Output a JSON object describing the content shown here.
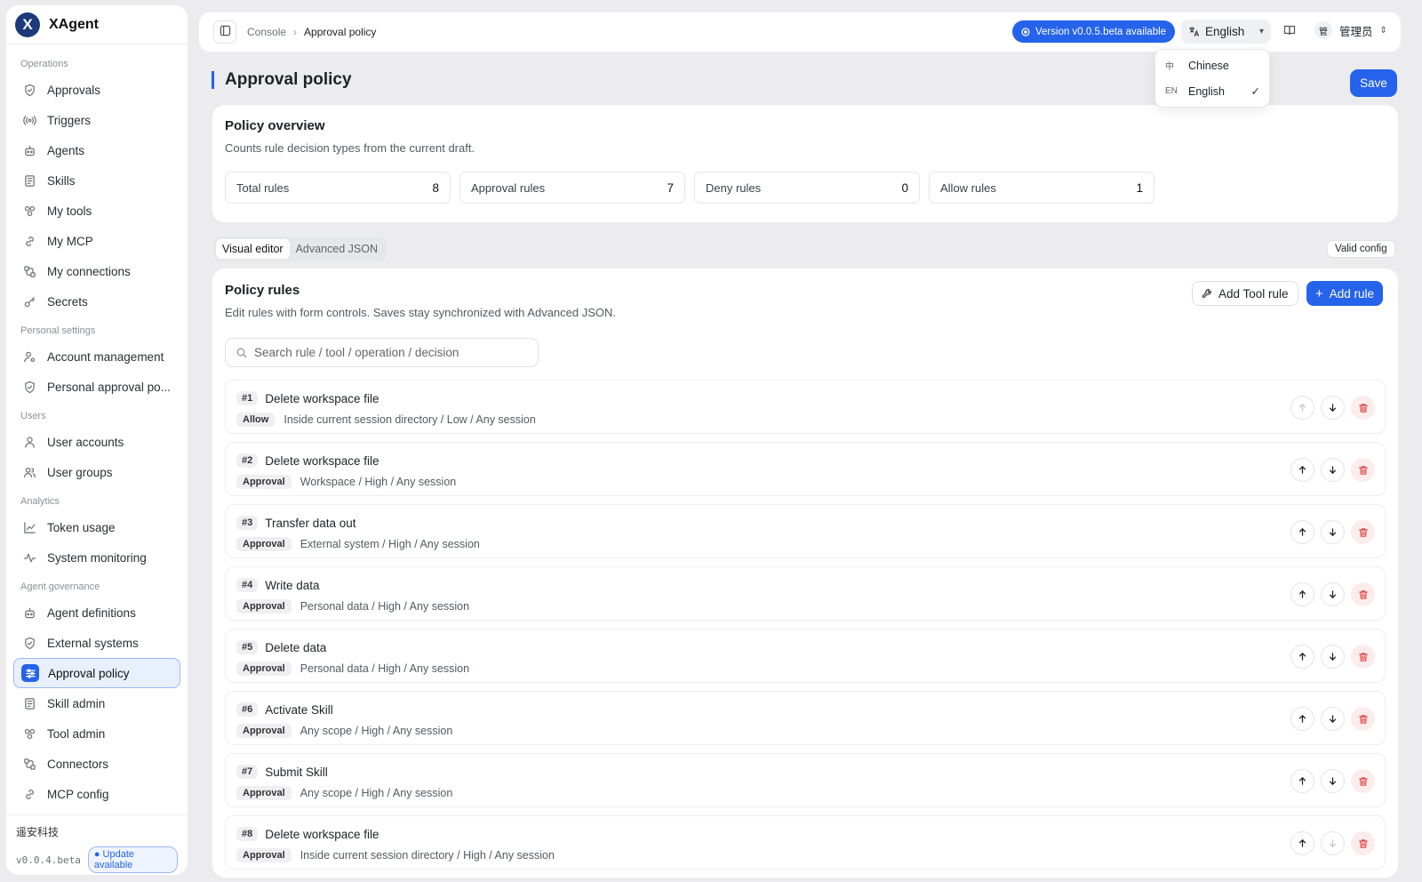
{
  "app": {
    "name": "XAgent",
    "logo_letter": "X"
  },
  "sidebar": {
    "sections": [
      {
        "title": "Operations",
        "items": [
          {
            "label": "Approvals",
            "icon": "shield-icon"
          },
          {
            "label": "Triggers",
            "icon": "broadcast-icon"
          },
          {
            "label": "Agents",
            "icon": "bot-icon"
          },
          {
            "label": "Skills",
            "icon": "book-icon"
          },
          {
            "label": "My tools",
            "icon": "tools-icon"
          },
          {
            "label": "My MCP",
            "icon": "link-icon"
          },
          {
            "label": "My connections",
            "icon": "connection-icon"
          },
          {
            "label": "Secrets",
            "icon": "key-icon"
          }
        ]
      },
      {
        "title": "Personal settings",
        "items": [
          {
            "label": "Account management",
            "icon": "user-gear-icon"
          },
          {
            "label": "Personal approval po...",
            "icon": "shield-icon"
          }
        ]
      },
      {
        "title": "Users",
        "items": [
          {
            "label": "User accounts",
            "icon": "user-icon"
          },
          {
            "label": "User groups",
            "icon": "users-icon"
          }
        ]
      },
      {
        "title": "Analytics",
        "items": [
          {
            "label": "Token usage",
            "icon": "chart-icon"
          },
          {
            "label": "System monitoring",
            "icon": "pulse-icon"
          }
        ]
      },
      {
        "title": "Agent governance",
        "items": [
          {
            "label": "Agent definitions",
            "icon": "bot-icon"
          },
          {
            "label": "External systems",
            "icon": "shield-icon"
          },
          {
            "label": "Approval policy",
            "icon": "sliders-icon",
            "active": true
          },
          {
            "label": "Skill admin",
            "icon": "book-icon"
          },
          {
            "label": "Tool admin",
            "icon": "tools-icon"
          },
          {
            "label": "Connectors",
            "icon": "connection-icon"
          },
          {
            "label": "MCP config",
            "icon": "link-icon"
          }
        ]
      }
    ],
    "footer": {
      "company": "遥安科技",
      "version": "v0.0.4.beta",
      "update_label": "● Update available"
    }
  },
  "topbar": {
    "breadcrumb": [
      "Console",
      "Approval policy"
    ],
    "version_pill": "Version v0.0.5.beta available",
    "language": "English",
    "user": {
      "avatar": "管",
      "name": "管理员"
    }
  },
  "language_menu": {
    "options": [
      {
        "code": "中",
        "label": "Chinese",
        "selected": false
      },
      {
        "code": "EN",
        "label": "English",
        "selected": true
      }
    ]
  },
  "page": {
    "title": "Approval policy",
    "save_label": "Save"
  },
  "overview": {
    "title": "Policy overview",
    "subtitle": "Counts rule decision types from the current draft.",
    "stats": [
      {
        "label": "Total rules",
        "value": "8"
      },
      {
        "label": "Approval rules",
        "value": "7"
      },
      {
        "label": "Deny rules",
        "value": "0"
      },
      {
        "label": "Allow rules",
        "value": "1"
      }
    ]
  },
  "mode_tabs": [
    {
      "label": "Visual editor",
      "active": true
    },
    {
      "label": "Advanced JSON",
      "active": false
    }
  ],
  "valid_label": "Valid config",
  "rules_panel": {
    "title": "Policy rules",
    "subtitle": "Edit rules with form controls. Saves stay synchronized with Advanced JSON.",
    "add_tool_label": "Add Tool rule",
    "add_rule_label": "Add rule",
    "search_placeholder": "Search rule / tool / operation / decision",
    "rules": [
      {
        "index": "#1",
        "name": "Delete workspace file",
        "decision": "Allow",
        "desc": "Inside current session directory / Low / Any session",
        "up_disabled": true,
        "down_disabled": false
      },
      {
        "index": "#2",
        "name": "Delete workspace file",
        "decision": "Approval",
        "desc": "Workspace / High / Any session",
        "up_disabled": false,
        "down_disabled": false
      },
      {
        "index": "#3",
        "name": "Transfer data out",
        "decision": "Approval",
        "desc": "External system / High / Any session",
        "up_disabled": false,
        "down_disabled": false
      },
      {
        "index": "#4",
        "name": "Write data",
        "decision": "Approval",
        "desc": "Personal data / High / Any session",
        "up_disabled": false,
        "down_disabled": false
      },
      {
        "index": "#5",
        "name": "Delete data",
        "decision": "Approval",
        "desc": "Personal data / High / Any session",
        "up_disabled": false,
        "down_disabled": false
      },
      {
        "index": "#6",
        "name": "Activate Skill",
        "decision": "Approval",
        "desc": "Any scope / High / Any session",
        "up_disabled": false,
        "down_disabled": false
      },
      {
        "index": "#7",
        "name": "Submit Skill",
        "decision": "Approval",
        "desc": "Any scope / High / Any session",
        "up_disabled": false,
        "down_disabled": false
      },
      {
        "index": "#8",
        "name": "Delete workspace file",
        "decision": "Approval",
        "desc": "Inside current session directory / High / Any session",
        "up_disabled": false,
        "down_disabled": true
      }
    ]
  }
}
